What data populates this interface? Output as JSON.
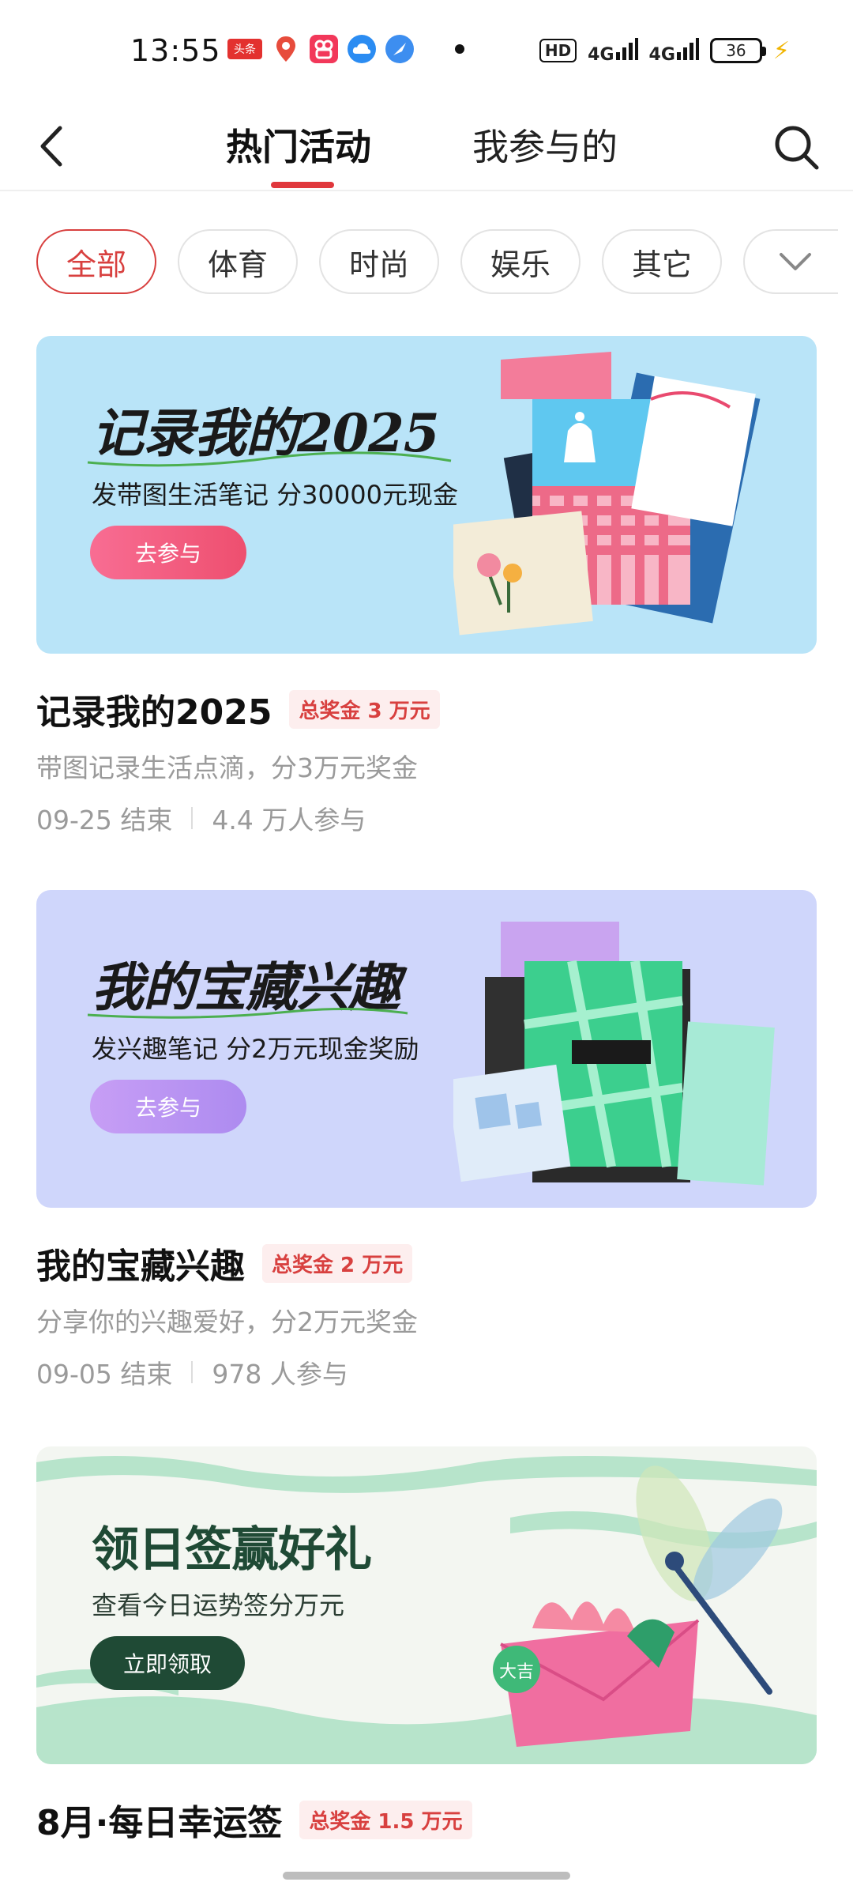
{
  "status_bar": {
    "time": "13:55",
    "hd": "HD",
    "signal1": "4G",
    "signal2": "4G",
    "battery": "36",
    "apps": [
      "头条",
      "地图",
      "快手",
      "云盘",
      "浏览器"
    ]
  },
  "header": {
    "tabs": [
      {
        "label": "热门活动",
        "active": true
      },
      {
        "label": "我参与的",
        "active": false
      }
    ]
  },
  "filters": {
    "chips": [
      "全部",
      "体育",
      "时尚",
      "娱乐",
      "其它"
    ],
    "active": "全部"
  },
  "activities": [
    {
      "banner_title": "记录我的2025",
      "banner_subtitle": "发带图生活笔记  分30000元现金",
      "banner_button": "去参与",
      "banner_bg": "#b9e4f8",
      "button_color": "#f0537a",
      "title": "记录我的2025",
      "prize": "总奖金 3 万元",
      "desc": "带图记录生活点滴，分3万元奖金",
      "end": "09-25 结束",
      "participants": "4.4 万人参与"
    },
    {
      "banner_title": "我的宝藏兴趣",
      "banner_subtitle": "发兴趣笔记  分2万元现金奖励",
      "banner_button": "去参与",
      "banner_bg": "#cfd6fb",
      "button_color": "#b58cf0",
      "title": "我的宝藏兴趣",
      "prize": "总奖金 2 万元",
      "desc": "分享你的兴趣爱好，分2万元奖金",
      "end": "09-05 结束",
      "participants": "978 人参与"
    },
    {
      "banner_title": "领日签赢好礼",
      "banner_subtitle": "查看今日运势签分万元",
      "banner_button": "立即领取",
      "banner_bg": "#f3f6f1",
      "button_color": "#1f4a35",
      "title": "8月·每日幸运签",
      "prize": "总奖金 1.5 万元",
      "art_label": "大吉"
    }
  ]
}
